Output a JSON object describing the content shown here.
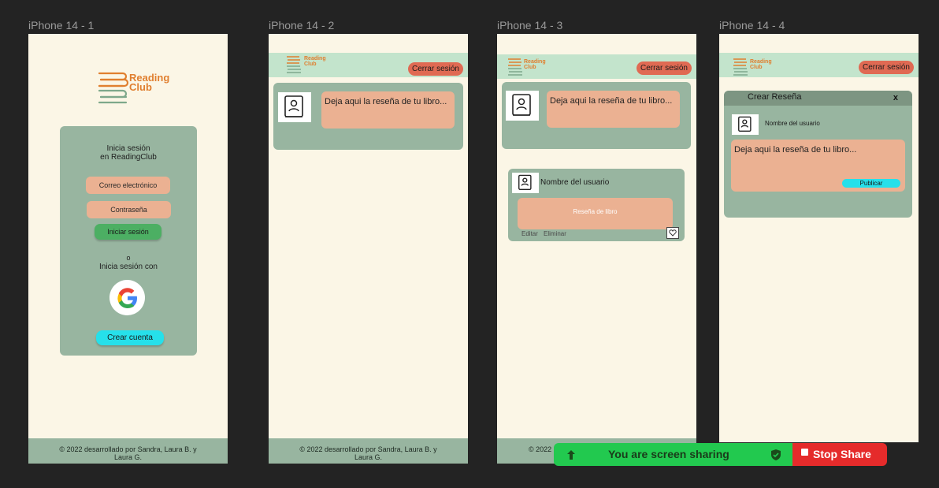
{
  "frames": {
    "f1": {
      "label": "iPhone 14 - 1",
      "logo": {
        "line1": "Reading",
        "line2": "Club"
      },
      "login": {
        "heading1": "Inicia sesión",
        "heading2": "en ReadingClub",
        "email_placeholder": "Correo electrónico",
        "password_placeholder": "Contraseña",
        "login_button": "Iniciar sesión",
        "or": "o",
        "alt_login": "Inicia sesión con",
        "create_account": "Crear cuenta"
      },
      "footer": {
        "line1": "© 2022 desarrollado por Sandra, Laura B. y",
        "line2": "Laura G."
      }
    },
    "f2": {
      "label": "iPhone 14 - 2",
      "logo": {
        "line1": "Reading",
        "line2": "Club"
      },
      "logout": "Cerrar sesión",
      "review_placeholder": "Deja aqui la reseña de tu libro...",
      "footer": {
        "line1": "© 2022 desarrollado por Sandra, Laura B. y",
        "line2": "Laura G."
      }
    },
    "f3": {
      "label": "iPhone 14 - 3",
      "logo": {
        "line1": "Reading",
        "line2": "Club"
      },
      "logout": "Cerrar sesión",
      "review_placeholder": "Deja aqui la reseña de tu libro...",
      "post": {
        "username": "Nombre del usuario",
        "review": "Reseña de libro",
        "edit": "Editar",
        "delete": "Eliminar"
      },
      "footer": {
        "line1": "© 2022"
      }
    },
    "f4": {
      "label": "iPhone 14 - 4",
      "logo": {
        "line1": "Reading",
        "line2": "Club"
      },
      "logout": "Cerrar sesión",
      "modal": {
        "title": "Crear Reseña",
        "close": "x",
        "username": "Nombre del usuario",
        "review_placeholder": "Deja aqui la reseña de tu libro...",
        "publish": "Publicar"
      }
    }
  },
  "share_bar": {
    "sharing_text": "You are screen sharing",
    "stop_label": "Stop Share"
  },
  "colors": {
    "background": "#232323",
    "frame": "#fbf6e6",
    "sage": "#98b5a0",
    "mint": "#c3e4cc",
    "peach": "#ebb192",
    "brand_orange": "#e07f2f",
    "logout_red": "#e06a53",
    "cyan": "#26e0ea",
    "green_button": "#4caf63"
  }
}
